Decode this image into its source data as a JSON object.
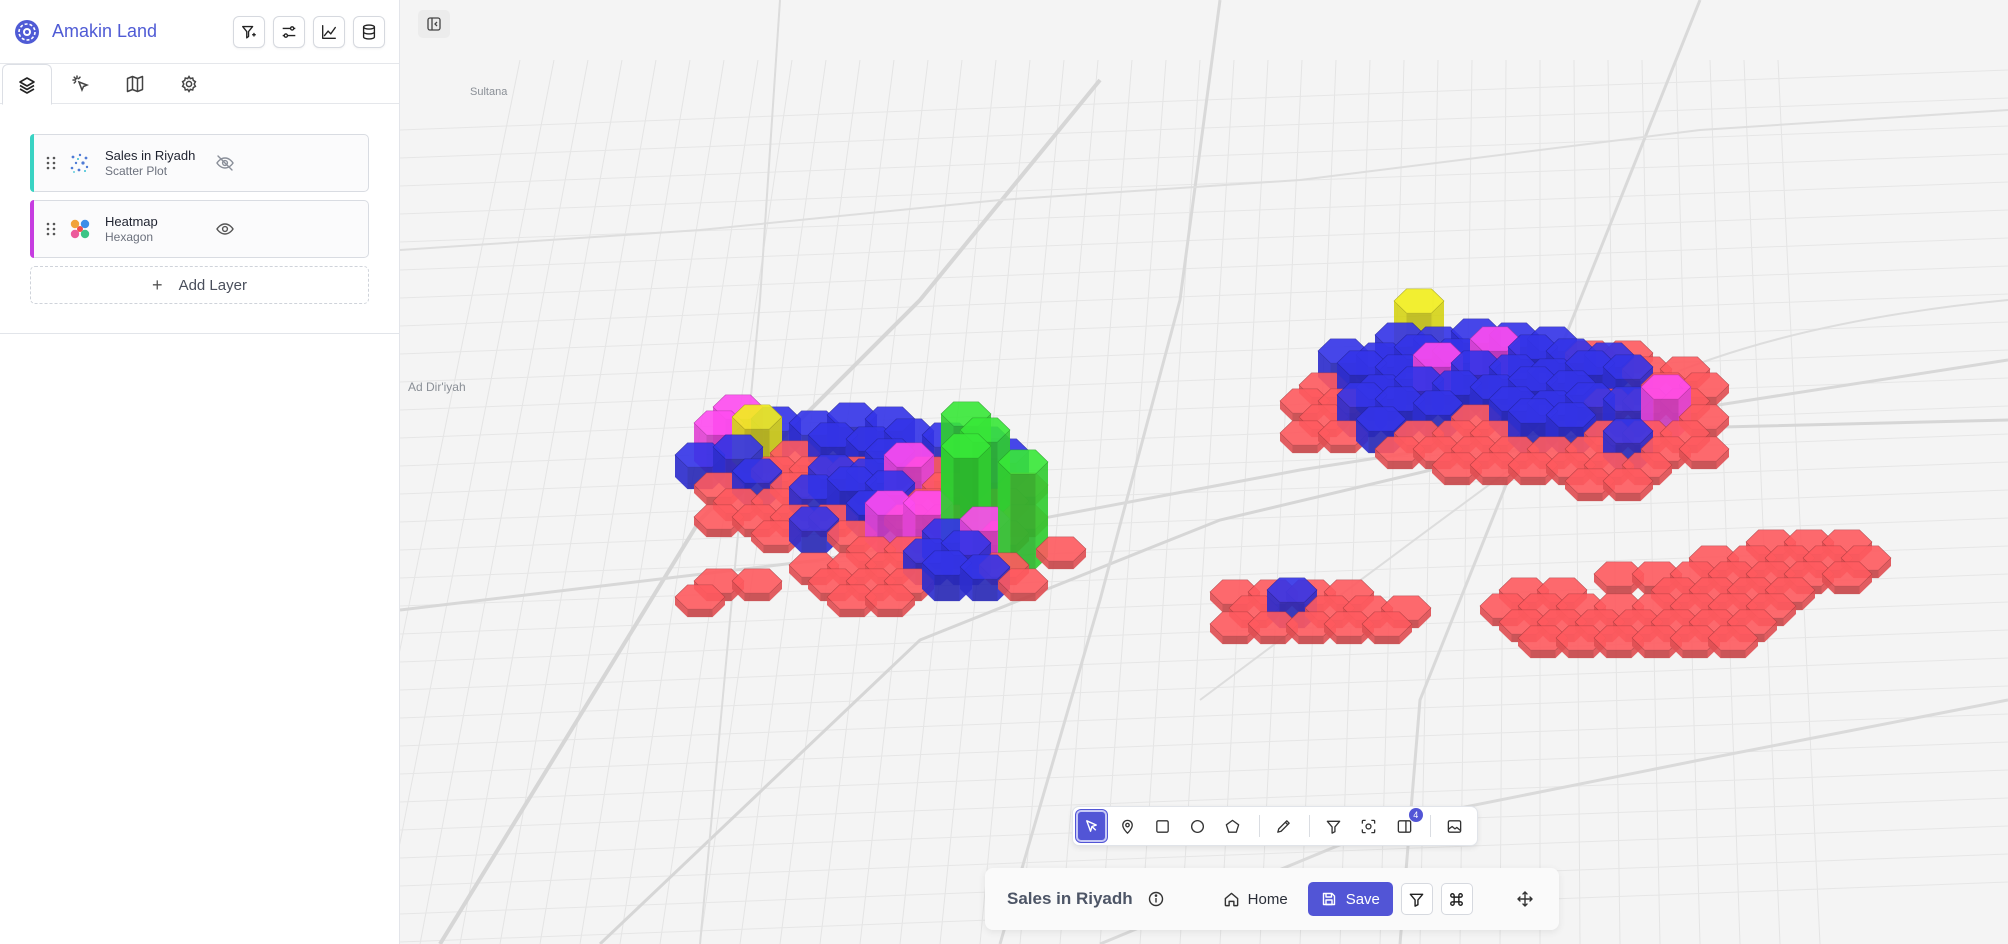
{
  "app": {
    "title": "Amakin Land"
  },
  "sidebar": {
    "header_buttons": [
      {
        "name": "filter-sparkle-icon"
      },
      {
        "name": "settings-sliders-icon"
      },
      {
        "name": "chart-icon"
      },
      {
        "name": "database-icon"
      }
    ],
    "tabs": [
      {
        "name": "layers-icon",
        "active": true
      },
      {
        "name": "interactions-icon",
        "active": false
      },
      {
        "name": "map-icon",
        "active": false
      },
      {
        "name": "gear-icon",
        "active": false
      }
    ],
    "layers": [
      {
        "name": "Sales in Riyadh",
        "type": "Scatter Plot",
        "accent": "#39d3c3",
        "visible": false
      },
      {
        "name": "Heatmap",
        "type": "Hexagon",
        "accent": "#c63de0",
        "visible": true
      }
    ],
    "add_layer_label": "Add Layer"
  },
  "map": {
    "places": [
      {
        "label": "Sultana"
      },
      {
        "label": "Ad Dir'iyah"
      }
    ],
    "hex_colors": {
      "low": "#ff5a5f",
      "mid": "#3434e8",
      "high": "#ff4cf0",
      "higher": "#f2ef1c",
      "max": "#38e838"
    }
  },
  "toolbar": {
    "tools": [
      "pointer-icon",
      "pin-icon",
      "rectangle-icon",
      "circle-icon",
      "polygon-icon",
      "pencil-icon",
      "filter-icon",
      "focus-icon",
      "panel-icon",
      "image-icon"
    ],
    "panel_badge": "4"
  },
  "bottombar": {
    "title": "Sales in Riyadh",
    "home_label": "Home",
    "save_label": "Save"
  },
  "colors": {
    "accent": "#5255d6",
    "brand": "#4f5bd5"
  }
}
